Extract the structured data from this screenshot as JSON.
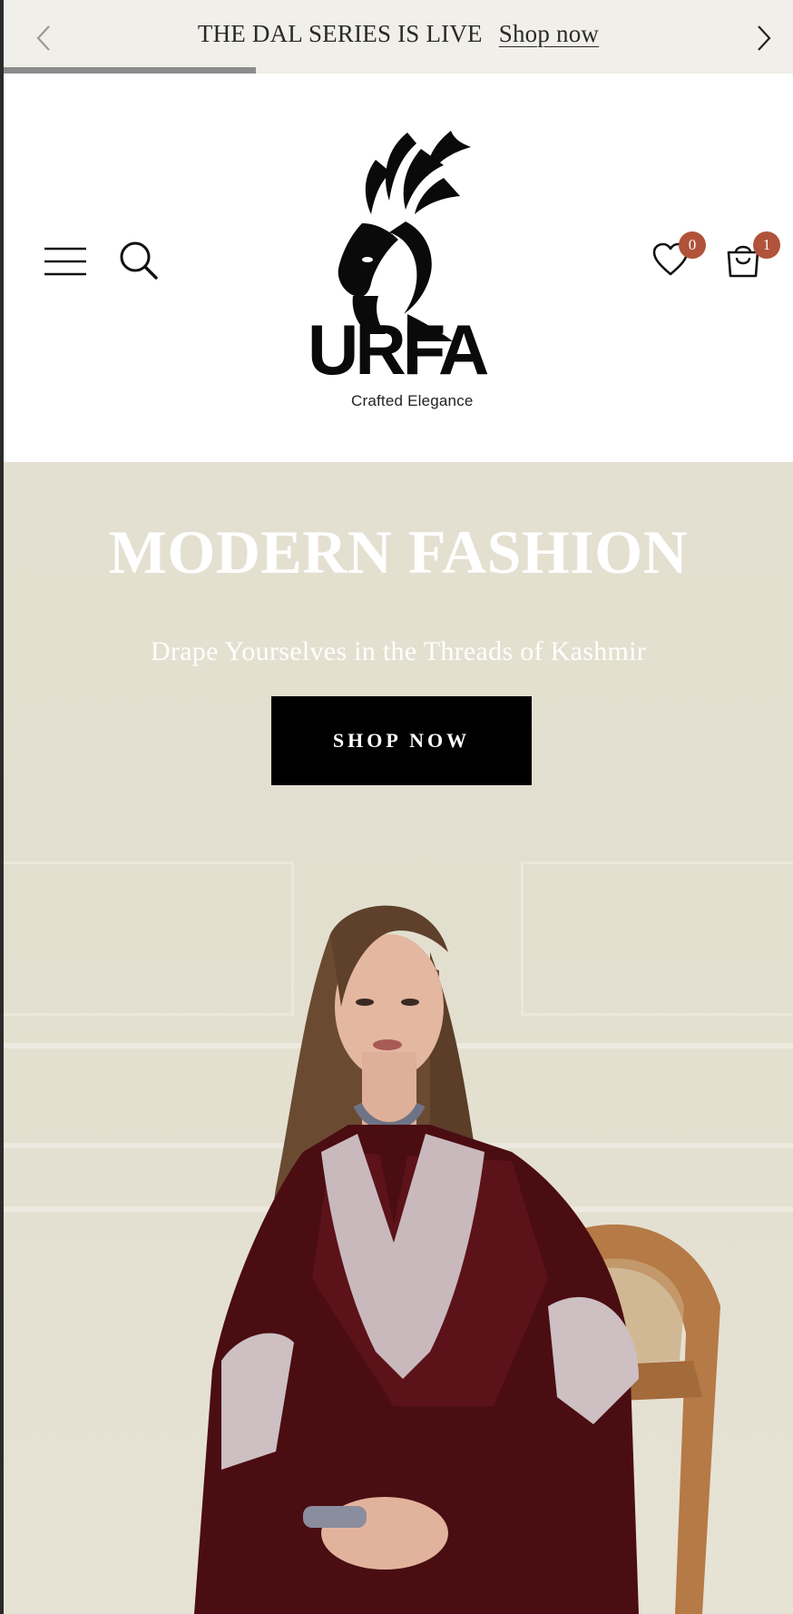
{
  "announcement": {
    "message": "THE DAL SERIES IS LIVE",
    "link_label": "Shop now",
    "slide_progress": 0.32
  },
  "header": {
    "icons": {
      "menu": "hamburger-menu-icon",
      "search": "search-icon",
      "wishlist": "heart-icon",
      "cart": "shopping-bag-icon"
    },
    "wishlist_count": "0",
    "cart_count": "1",
    "badge_color": "#b0533a"
  },
  "logo": {
    "wordmark": "URFA",
    "tagline": "Crafted Elegance"
  },
  "hero": {
    "title": "MODERN FASHION",
    "subtitle": "Drape Yourselves in the Threads of Kashmir",
    "cta_label": "SHOP NOW",
    "background_color": "#e4e0d1"
  }
}
